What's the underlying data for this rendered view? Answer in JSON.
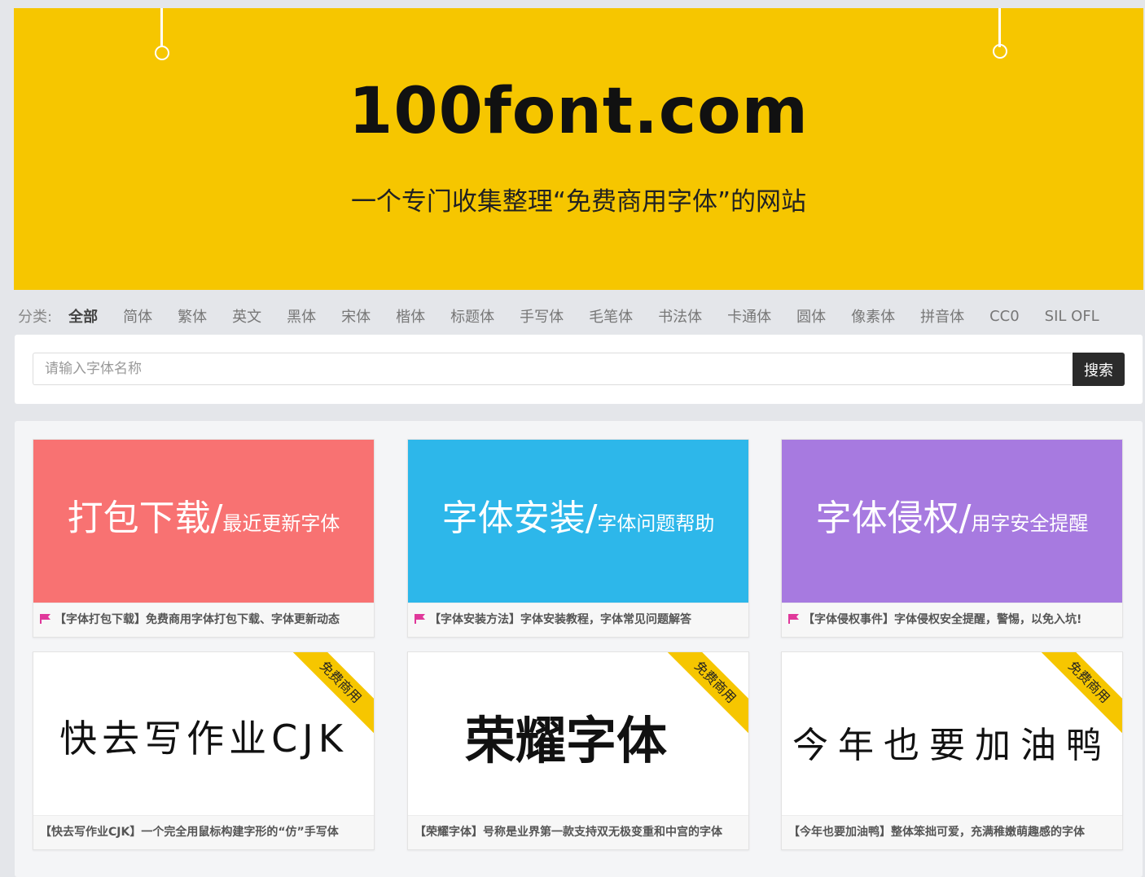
{
  "banner": {
    "logo": "100font.com",
    "slogan": "一个专门收集整理“免费商用字体”的网站"
  },
  "categories": {
    "label": "分类:",
    "items": [
      "全部",
      "简体",
      "繁体",
      "英文",
      "黑体",
      "宋体",
      "楷体",
      "标题体",
      "手写体",
      "毛笔体",
      "书法体",
      "卡通体",
      "圆体",
      "像素体",
      "拼音体",
      "CC0",
      "SIL OFL"
    ],
    "active": "全部"
  },
  "search": {
    "placeholder": "请输入字体名称",
    "button": "搜索"
  },
  "colors": {
    "banner": "#f6c600",
    "card_red": "#f87272",
    "card_blue": "#2db7ea",
    "card_purple": "#a77ae0",
    "flag": "#e0389a",
    "ribbon": "#f6c600"
  },
  "topics": [
    {
      "main": "打包下载",
      "slash": "/",
      "sub": "最近更新字体",
      "caption": "【字体打包下载】免费商用字体打包下载、字体更新动态"
    },
    {
      "main": "字体安装",
      "slash": "/",
      "sub": "字体问题帮助",
      "caption": "【字体安装方法】字体安装教程，字体常见问题解答"
    },
    {
      "main": "字体侵权",
      "slash": "/",
      "sub": "用字安全提醒",
      "caption": "【字体侵权事件】字体侵权安全提醒，警惕，以免入坑!"
    }
  ],
  "fonts": [
    {
      "sample": "快去写作业CJK",
      "ribbon": "免费商用",
      "caption": "【快去写作业CJK】一个完全用鼠标构建字形的“仿”手写体"
    },
    {
      "sample": "荣耀字体",
      "ribbon": "免费商用",
      "caption": "【荣耀字体】号称是业界第一款支持双无极变重和中宫的字体"
    },
    {
      "sample": "今年也要加油鸭",
      "ribbon": "免费商用",
      "caption": "【今年也要加油鸭】整体笨拙可爱，充满稚嫩萌趣感的字体"
    }
  ]
}
